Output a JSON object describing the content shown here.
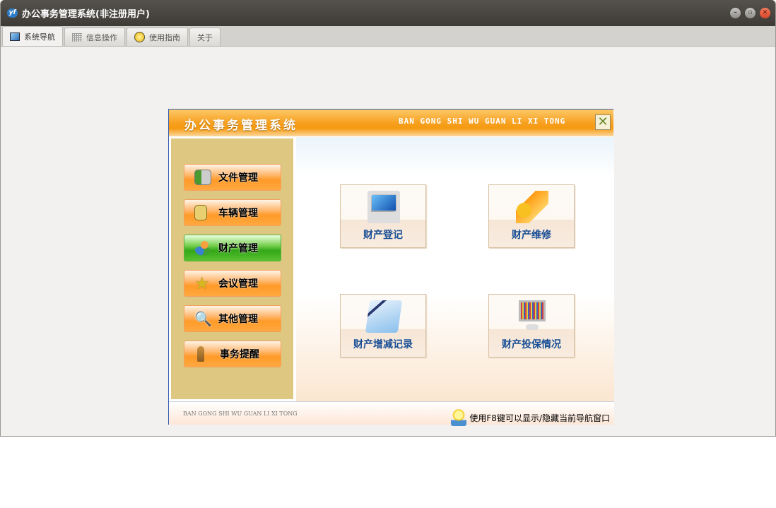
{
  "window": {
    "title": "办公事务管理系统(非注册用户)",
    "app_icon": "yf-logo"
  },
  "tabs": [
    {
      "label": "系统导航",
      "icon": "monitor-icon"
    },
    {
      "label": "信息操作",
      "icon": "grid-icon"
    },
    {
      "label": "使用指南",
      "icon": "help-icon"
    },
    {
      "label": "关于"
    }
  ],
  "dialog": {
    "title": "办公事务管理系统",
    "pinyin": "BAN GONG SHI WU  GUAN LI XI TONG",
    "nav": [
      {
        "label": "文件管理",
        "icon": "contact-card-icon"
      },
      {
        "label": "车辆管理",
        "icon": "document-icon"
      },
      {
        "label": "财产管理",
        "icon": "users-icon",
        "active": true
      },
      {
        "label": "会议管理",
        "icon": "star-icon"
      },
      {
        "label": "其他管理",
        "icon": "magnifier-icon"
      },
      {
        "label": "事务提醒",
        "icon": "person-icon"
      }
    ],
    "cards": [
      {
        "label": "财产登记",
        "icon": "computer-edit-icon"
      },
      {
        "label": "财产维修",
        "icon": "coins-laptop-icon"
      },
      {
        "label": "财产增减记录",
        "icon": "notepad-pen-icon"
      },
      {
        "label": "财产投保情况",
        "icon": "monitor-chart-icon"
      }
    ],
    "footer_pinyin": "BAN GONG SHI WU GUAN LI XI TONG",
    "footer_tip": "使用F8键可以显示/隐藏当前导航窗口"
  }
}
